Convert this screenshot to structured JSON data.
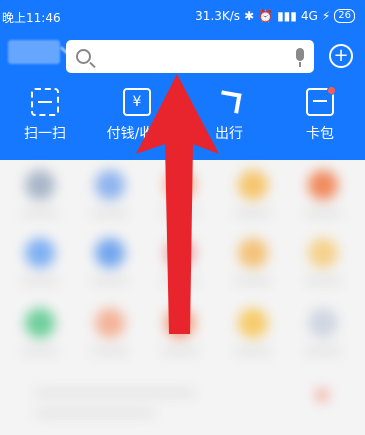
{
  "status_bar": {
    "time": "晚上11:46",
    "network_speed": "31.3K/s",
    "signal_text": "4G",
    "battery": "26"
  },
  "header": {
    "search": {
      "placeholder": ""
    }
  },
  "quick_actions": [
    {
      "label": "扫一扫",
      "icon": "scan-icon"
    },
    {
      "label": "付钱/收钱",
      "icon": "yen-icon"
    },
    {
      "label": "出行",
      "icon": "travel-icon"
    },
    {
      "label": "卡包",
      "icon": "card-icon"
    }
  ],
  "colors": {
    "header_bg": "#1677ff",
    "arrow": "#e8252d",
    "card_dot": "#ff5b4d"
  }
}
